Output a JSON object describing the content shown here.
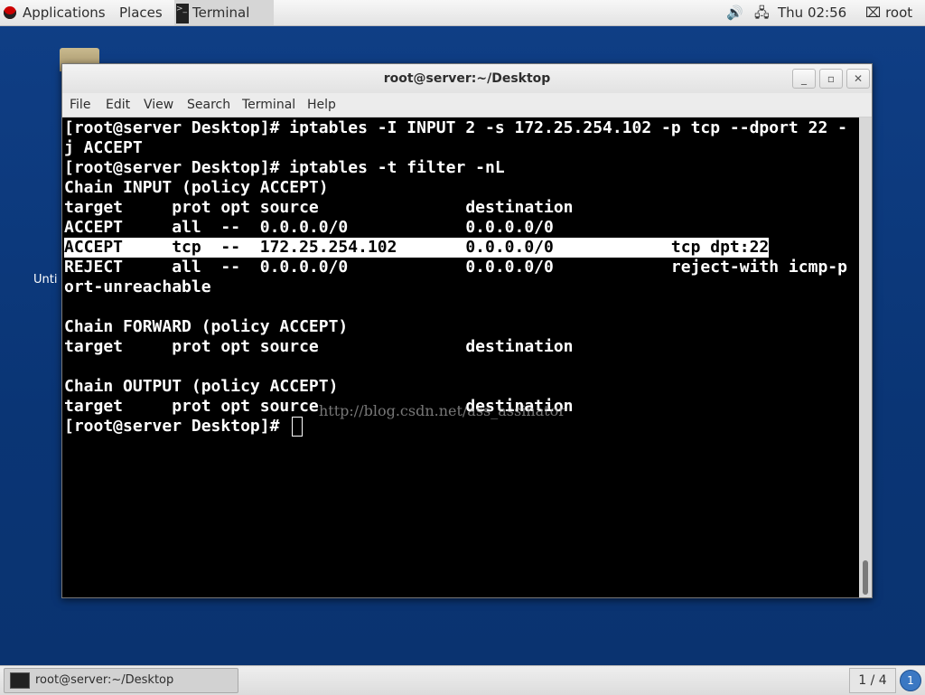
{
  "top_panel": {
    "applications": "Applications",
    "places": "Places",
    "terminal": "Terminal",
    "clock": "Thu 02:56",
    "user": "root"
  },
  "desktop": {
    "folder_label": "Unti"
  },
  "window": {
    "title": "root@server:~/Desktop",
    "menu": [
      "File",
      "Edit",
      "View",
      "Search",
      "Terminal",
      "Help"
    ]
  },
  "terminal": {
    "lines": [
      "[root@server Desktop]# iptables -I INPUT 2 -s 172.25.254.102 -p tcp --dport 22 -",
      "j ACCEPT",
      "[root@server Desktop]# iptables -t filter -nL",
      "Chain INPUT (policy ACCEPT)",
      "target     prot opt source               destination",
      "ACCEPT     all  --  0.0.0.0/0            0.0.0.0/0",
      "ACCEPT     tcp  --  172.25.254.102       0.0.0.0/0            tcp dpt:22",
      "REJECT     all  --  0.0.0.0/0            0.0.0.0/0            reject-with icmp-p",
      "ort-unreachable",
      "",
      "Chain FORWARD (policy ACCEPT)",
      "target     prot opt source               destination",
      "",
      "Chain OUTPUT (policy ACCEPT)",
      "target     prot opt source               destination",
      "[root@server Desktop]# "
    ],
    "watermark": "http://blog.csdn.net/ass_assinator"
  },
  "taskbar": {
    "task_label": "root@server:~/Desktop",
    "workspace": "1 / 4",
    "notifications": "1"
  }
}
